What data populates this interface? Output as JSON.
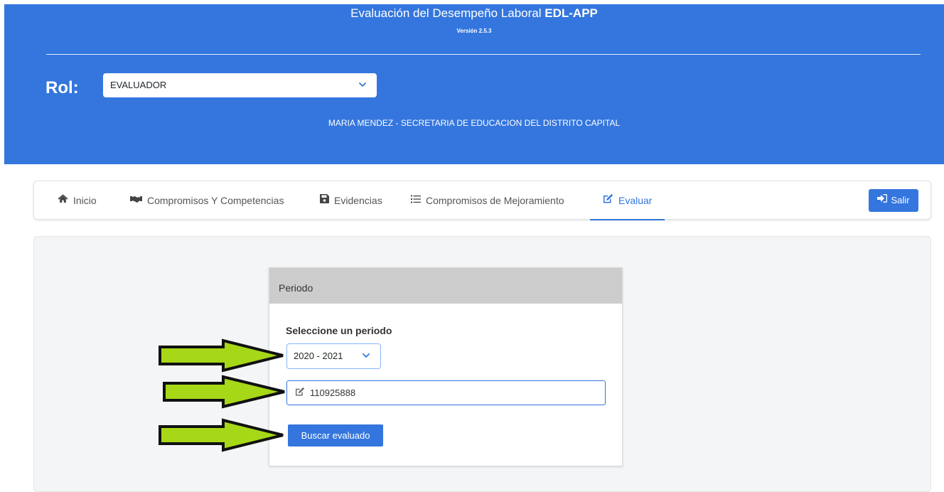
{
  "header": {
    "title_plain": "Evaluación del Desempeño Laboral",
    "title_bold": "EDL-APP",
    "version": "Versión 2.5.3",
    "rol_label": "Rol:",
    "rol_value": "EVALUADOR",
    "user_line": "MARIA MENDEZ - SECRETARIA DE EDUCACION DEL DISTRITO CAPITAL"
  },
  "nav": {
    "items": [
      {
        "label": "Inicio",
        "icon": "home-icon"
      },
      {
        "label": "Compromisos Y Competencias",
        "icon": "handshake-icon"
      },
      {
        "label": "Evidencias",
        "icon": "save-icon"
      },
      {
        "label": "Compromisos de Mejoramiento",
        "icon": "list-icon"
      },
      {
        "label": "Evaluar",
        "icon": "edit-icon",
        "active": true
      }
    ],
    "logout_label": "Salir"
  },
  "card": {
    "header": "Periodo",
    "field_label": "Seleccione un periodo",
    "period_value": "2020 - 2021",
    "document_value": "110925888",
    "search_label": "Buscar evaluado"
  },
  "colors": {
    "primary": "#3476dd",
    "arrow_fill": "#a6d817",
    "card_header": "#cccccc",
    "panel_bg": "#f4f5f6"
  }
}
